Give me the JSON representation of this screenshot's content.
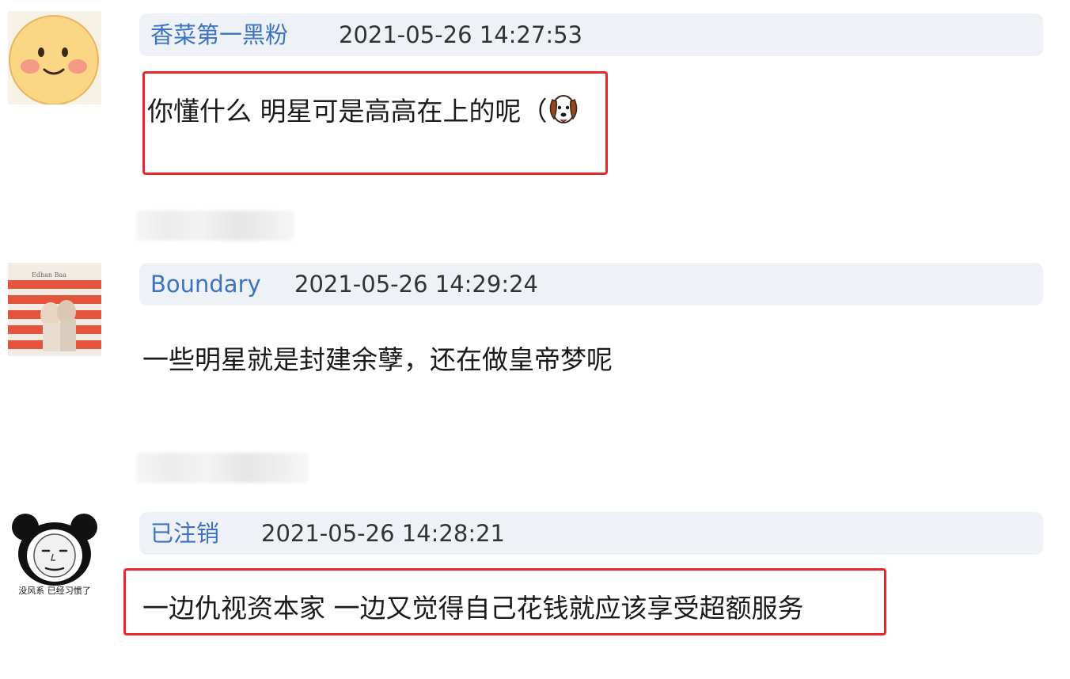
{
  "comments": [
    {
      "username": "香菜第一黑粉",
      "timestamp": "2021-05-26 14:27:53",
      "content": "你懂什么 明星可是高高在上的呢（",
      "emoji_icon": "dog-emoji-icon",
      "highlighted": true
    },
    {
      "username": "Boundary",
      "timestamp": "2021-05-26 14:29:24",
      "content": "一些明星就是封建余孽，还在做皇帝梦呢",
      "avatar_sign_text": "Edhan Baa",
      "highlighted": false
    },
    {
      "username": "已注销",
      "timestamp": "2021-05-26 14:28:21",
      "content": "一边仇视资本家 一边又觉得自己花钱就应该享受超额服务",
      "avatar_caption": "没风系 已经习惯了",
      "highlighted": true
    }
  ],
  "colors": {
    "username": "#3c73c2",
    "highlight": "#e8262b",
    "header_bg": "#eef2f6"
  }
}
